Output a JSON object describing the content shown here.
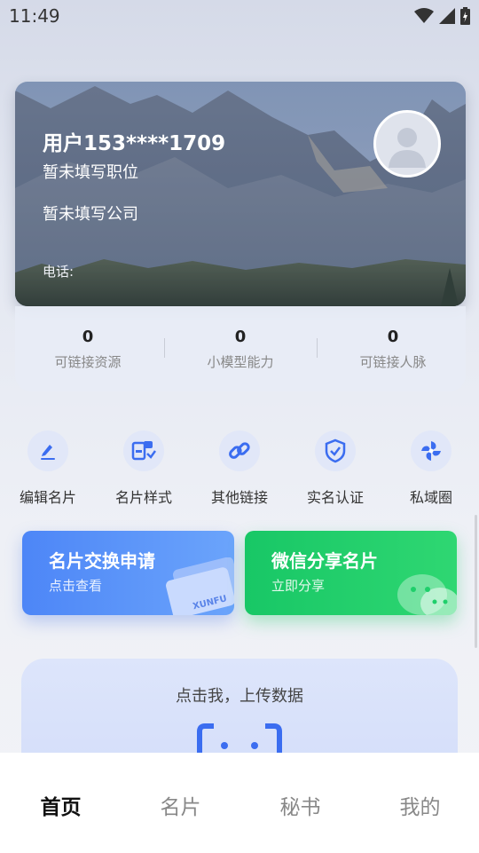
{
  "status_bar": {
    "time": "11:49"
  },
  "profile": {
    "name": "用户153****1709",
    "position": "暂未填写职位",
    "company": "暂未填写公司",
    "phone_label": "电话:"
  },
  "stats": [
    {
      "value": "0",
      "label": "可链接资源"
    },
    {
      "value": "0",
      "label": "小模型能力"
    },
    {
      "value": "0",
      "label": "可链接人脉"
    }
  ],
  "actions": [
    {
      "label": "编辑名片",
      "icon": "edit-icon"
    },
    {
      "label": "名片样式",
      "icon": "card-style-icon"
    },
    {
      "label": "其他链接",
      "icon": "link-icon"
    },
    {
      "label": "实名认证",
      "icon": "shield-check-icon"
    },
    {
      "label": "私域圈",
      "icon": "circle-pinwheel-icon"
    }
  ],
  "promos": {
    "exchange": {
      "title": "名片交换申请",
      "subtitle": "点击查看",
      "card_text": "XUNFU"
    },
    "wechat": {
      "title": "微信分享名片",
      "subtitle": "立即分享"
    }
  },
  "upload": {
    "text": "点击我，上传数据"
  },
  "bottom_nav": [
    {
      "label": "首页",
      "active": true
    },
    {
      "label": "名片",
      "active": false
    },
    {
      "label": "秘书",
      "active": false
    },
    {
      "label": "我的",
      "active": false
    }
  ],
  "colors": {
    "accent_blue": "#4d86f7",
    "accent_green": "#18c766",
    "icon_blue": "#3b6df0"
  }
}
